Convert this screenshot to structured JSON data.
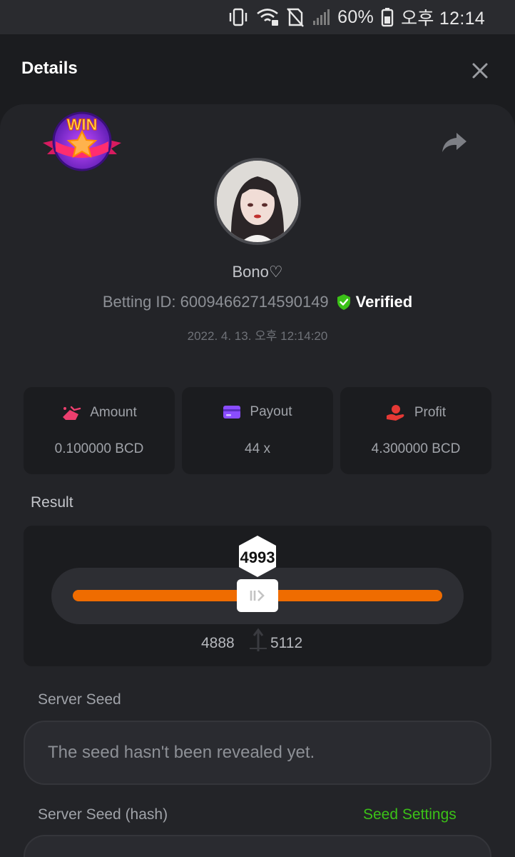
{
  "status_bar": {
    "battery": "60%",
    "time": "오후 12:14"
  },
  "header": {
    "title": "Details"
  },
  "user": {
    "name": "Bono♡",
    "betting_id": "Betting ID: 60094662714590149",
    "verified_label": "Verified",
    "timestamp": "2022. 4. 13. 오후 12:14:20"
  },
  "badge": {
    "label": "WIN"
  },
  "stats": {
    "amount": {
      "label": "Amount",
      "value": "0.100000 BCD"
    },
    "payout": {
      "label": "Payout",
      "value": "44 x"
    },
    "profit": {
      "label": "Profit",
      "value": "4.300000 BCD"
    }
  },
  "result": {
    "label": "Result",
    "value": "4993",
    "range_low": "4888",
    "range_high": "5112"
  },
  "server_seed": {
    "label": "Server Seed",
    "value": "The seed hasn't been revealed yet."
  },
  "server_seed_hash": {
    "label": "Server Seed (hash)",
    "settings_link": "Seed Settings"
  },
  "colors": {
    "accent_green": "#3bc117",
    "slider_orange": "#ef6c00",
    "amount_icon": "#ec3f6e",
    "payout_icon": "#8a4dff",
    "profit_icon": "#e53935"
  }
}
